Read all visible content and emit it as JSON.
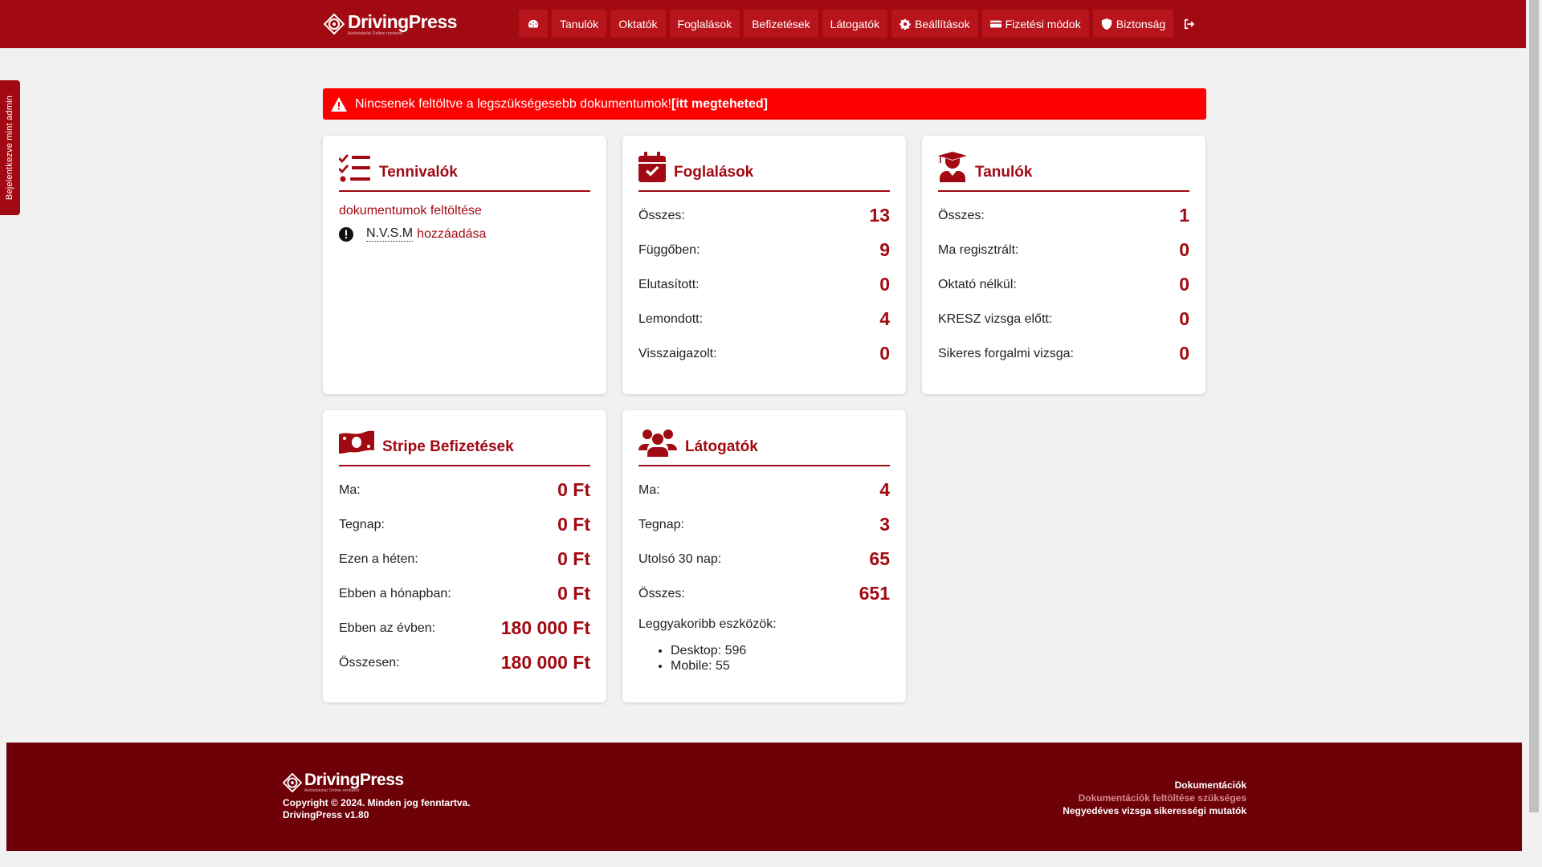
{
  "brand": {
    "name": "DrivingPress",
    "tagline": "Autósiskolai Online rendszer"
  },
  "nav": {
    "dashboard_icon": "dashboard-icon",
    "items": [
      "Tanulók",
      "Oktatók",
      "Foglalások",
      "Befizetések",
      "Látogatók"
    ],
    "settings": "Beállítások",
    "payment_methods": "Fizetési módok",
    "security": "Biztonság",
    "logout_icon": "logout-icon"
  },
  "side_tab": "Bejelentkezve mint admin",
  "alert": {
    "text": "Nincsenek feltöltve a legszükségesebb dokumentumok!",
    "link": "[itt megteheted]",
    "color": "#ff0000"
  },
  "todo": {
    "title": "Tennivalók",
    "link": "dokumentumok feltöltése",
    "abbr": "N.V.S.M",
    "add": "hozzáadása"
  },
  "bookings": {
    "title": "Foglalások",
    "rows": [
      {
        "label": "Összes:",
        "value": "13"
      },
      {
        "label": "Függőben:",
        "value": "9"
      },
      {
        "label": "Elutasított:",
        "value": "0"
      },
      {
        "label": "Lemondott:",
        "value": "4"
      },
      {
        "label": "Visszaigazolt:",
        "value": "0"
      }
    ]
  },
  "students": {
    "title": "Tanulók",
    "rows": [
      {
        "label": "Összes:",
        "value": "1"
      },
      {
        "label": "Ma regisztrált:",
        "value": "0"
      },
      {
        "label": "Oktató nélkül:",
        "value": "0"
      },
      {
        "label": "KRESZ vizsga előtt:",
        "value": "0"
      },
      {
        "label": "Sikeres forgalmi vizsga:",
        "value": "0"
      }
    ]
  },
  "payments": {
    "title": "Stripe Befizetések",
    "rows": [
      {
        "label": "Ma:",
        "value": "0 Ft"
      },
      {
        "label": "Tegnap:",
        "value": "0 Ft"
      },
      {
        "label": "Ezen a héten:",
        "value": "0 Ft"
      },
      {
        "label": "Ebben a hónapban:",
        "value": "0 Ft"
      },
      {
        "label": "Ebben az évben:",
        "value": "180 000 Ft"
      },
      {
        "label": "Összesen:",
        "value": "180 000 Ft"
      }
    ]
  },
  "visitors": {
    "title": "Látogatók",
    "rows": [
      {
        "label": "Ma:",
        "value": "4"
      },
      {
        "label": "Tegnap:",
        "value": "3"
      },
      {
        "label": "Utolsó 30 nap:",
        "value": "65"
      },
      {
        "label": "Összes:",
        "value": "651"
      }
    ],
    "devices_title": "Leggyakoribb eszközök:",
    "devices": [
      "Desktop: 596",
      "Mobile: 55"
    ]
  },
  "footer": {
    "copyright": "Copyright © 2024. Minden jog fenntartva.",
    "version": "DrivingPress v1.80",
    "links": [
      "Dokumentációk",
      "Dokumentációk feltöltése szükséges",
      "Negyedéves vizsga sikerességi mutatók"
    ]
  },
  "colors": {
    "primary": "#a10a12",
    "footer": "#6e0008",
    "nav_button": "#b8141c"
  }
}
